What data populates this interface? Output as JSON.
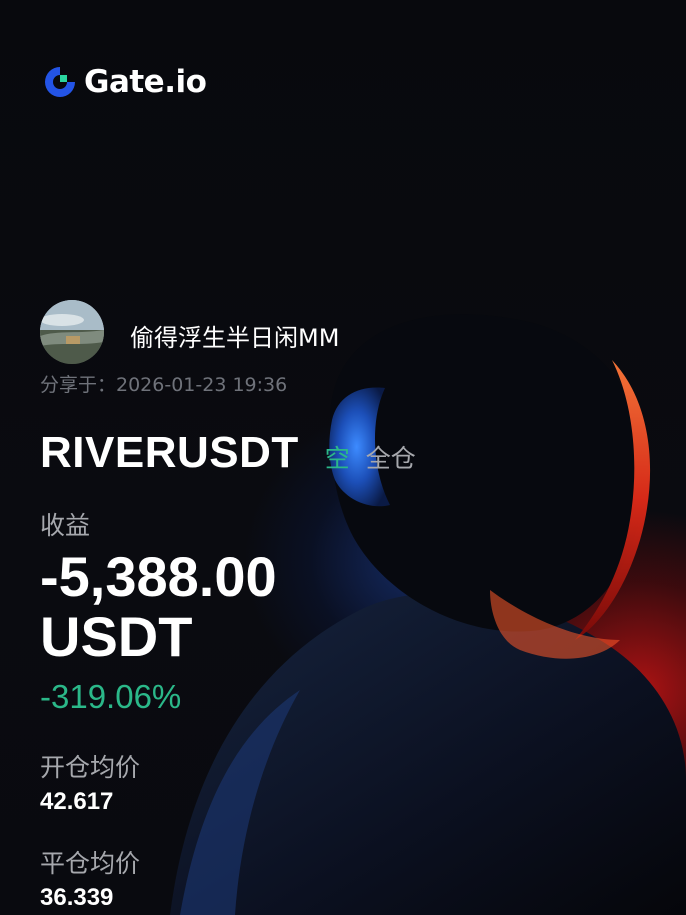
{
  "brand": {
    "name": "Gate.io",
    "icon": "gate-logo-icon",
    "accent": "#2354e6"
  },
  "user": {
    "name": "偷得浮生半日闲MM",
    "avatar_icon": "avatar-landscape"
  },
  "shared_at": "分享于：2026-01-23 19:36",
  "position": {
    "symbol": "RIVERUSDT",
    "direction": "空",
    "margin_mode": "全仓",
    "pnl_label": "收益",
    "pnl_value": "-5,388.00",
    "pnl_unit": "USDT",
    "roi": "-319.06%",
    "entry_price_label": "开仓均价",
    "entry_price": "42.617",
    "close_price_label": "平仓均价",
    "close_price": "36.339"
  },
  "colors": {
    "positive_green": "#2bb889",
    "muted_text": "#a6a8ad",
    "background": "#07080c"
  }
}
